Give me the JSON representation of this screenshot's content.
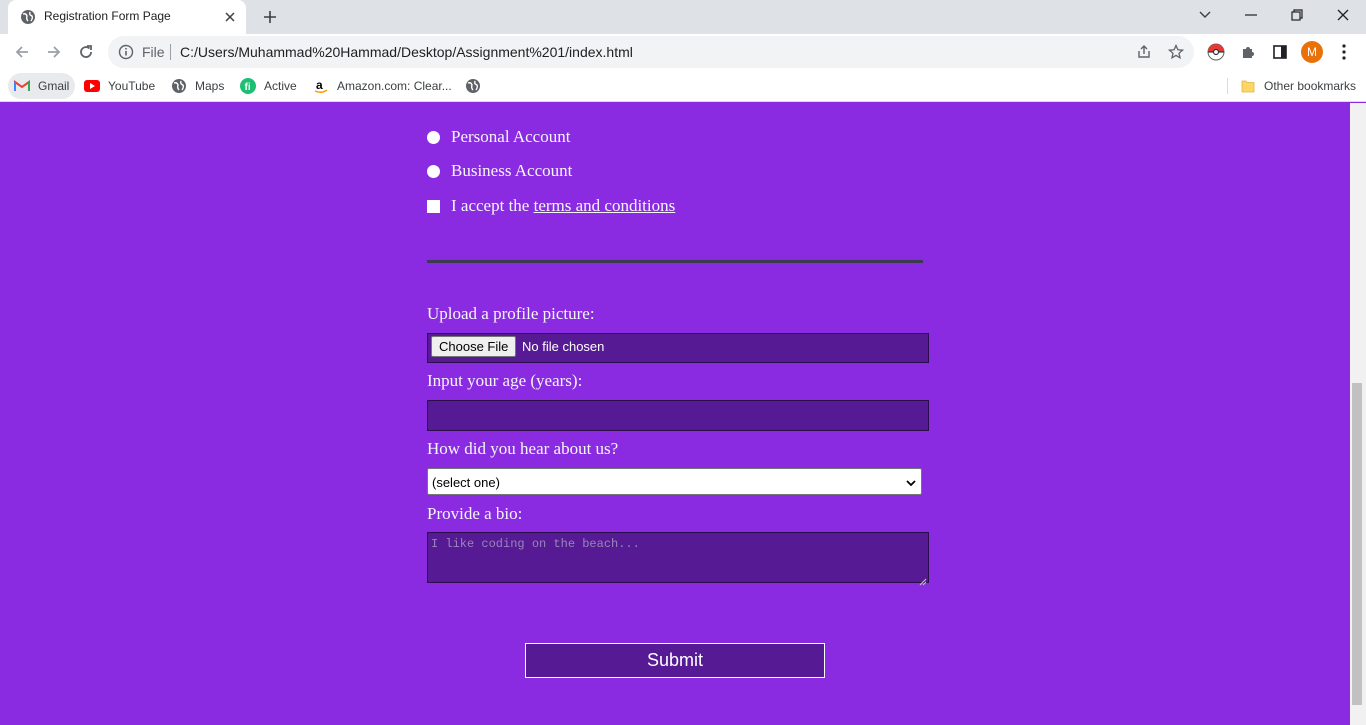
{
  "browser": {
    "tab_title": "Registration Form Page",
    "address_scheme_label": "File",
    "url": "C:/Users/Muhammad%20Hammad/Desktop/Assignment%201/index.html",
    "profile_initial": "M",
    "bookmarks": [
      {
        "label": "Gmail",
        "icon": "gmail-icon"
      },
      {
        "label": "YouTube",
        "icon": "youtube-icon"
      },
      {
        "label": "Maps",
        "icon": "globe-icon"
      },
      {
        "label": "Active",
        "icon": "fiverr-icon"
      },
      {
        "label": "Amazon.com: Clear...",
        "icon": "amazon-icon"
      },
      {
        "label": "",
        "icon": "globe-icon"
      }
    ],
    "other_bookmarks": "Other bookmarks"
  },
  "form": {
    "account_options": [
      "Personal Account",
      "Business Account"
    ],
    "terms_prefix": "I accept the ",
    "terms_link": "terms and conditions",
    "upload_label": "Upload a profile picture:",
    "choose_file": "Choose File",
    "no_file": "No file chosen",
    "age_label": "Input your age (years):",
    "age_value": "",
    "referrer_label": "How did you hear about us?",
    "referrer_selected": "(select one)",
    "bio_label": "Provide a bio:",
    "bio_placeholder": "I like coding on the beach...",
    "submit": "Submit"
  },
  "colors": {
    "page_background": "#8a2be2",
    "input_background": "#561a94",
    "text": "#f5f6f7"
  }
}
